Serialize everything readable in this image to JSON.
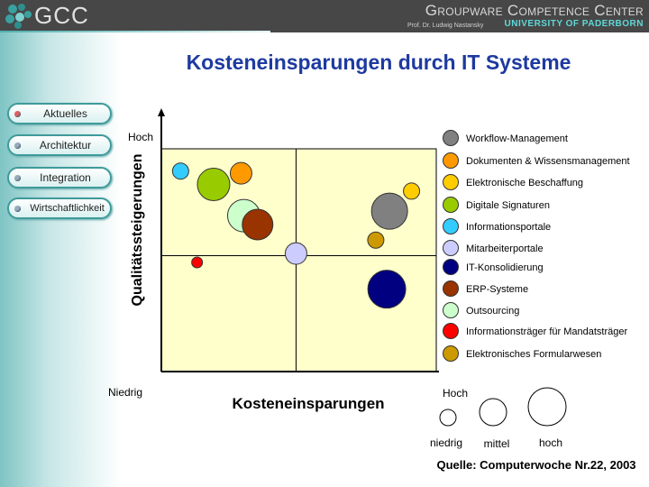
{
  "header": {
    "logo_text": "GCC",
    "org_name": "Groupware Competence Center",
    "professor": "Prof. Dr. Ludwig Nastansky",
    "university": "UNIVERSITY OF PADERBORN"
  },
  "nav": {
    "items": [
      {
        "label": "Aktuelles",
        "active": true
      },
      {
        "label": "Architektur",
        "active": false
      },
      {
        "label": "Integration",
        "active": false
      },
      {
        "label": "Wirtschaftlichkeit",
        "active": false
      }
    ]
  },
  "chart_data": {
    "type": "scatter",
    "title": "Kosteneinsparungen durch IT Systeme",
    "xlabel": "Kosteneinsparungen",
    "ylabel": "Qualitätssteigerungen",
    "x_low_label": "Niedrig",
    "x_high_label": "Hoch",
    "y_high_label": "Hoch",
    "xlim": [
      0,
      100
    ],
    "ylim": [
      0,
      100
    ],
    "quadrant_lines": {
      "x": 49,
      "y": 52
    },
    "background_color": "#ffffcc",
    "legend_placement": "right",
    "series": [
      {
        "name": "Workflow-Management",
        "color": "#808080",
        "x": 83,
        "y": 72,
        "size": 20
      },
      {
        "name": "Dokumenten & Wissensmanagement",
        "color": "#ff9900",
        "x": 29,
        "y": 89,
        "size": 12
      },
      {
        "name": "Elektronische Beschaffung",
        "color": "#ffcc00",
        "x": 91,
        "y": 81,
        "size": 9
      },
      {
        "name": "Digitale Signaturen",
        "color": "#99cc00",
        "x": 19,
        "y": 84,
        "size": 18
      },
      {
        "name": "Informationsportale",
        "color": "#33ccff",
        "x": 7,
        "y": 90,
        "size": 9
      },
      {
        "name": "Mitarbeiterportale",
        "color": "#ccccff",
        "x": 49,
        "y": 53,
        "size": 12
      },
      {
        "name": "IT-Konsolidierung",
        "color": "#000080",
        "x": 82,
        "y": 37,
        "size": 21
      },
      {
        "name": "ERP-Systeme",
        "color": "#993300",
        "x": 35,
        "y": 66,
        "size": 17
      },
      {
        "name": "Outsourcing",
        "color": "#ccffcc",
        "x": 30,
        "y": 70,
        "size": 18
      },
      {
        "name": "Informationsträger für Mandatsträger",
        "color": "#ff0000",
        "x": 13,
        "y": 49,
        "size": 6
      },
      {
        "name": "Elektronisches Formularwesen",
        "color": "#cc9900",
        "x": 78,
        "y": 59,
        "size": 9
      }
    ],
    "size_legend": {
      "title": "Hoch",
      "items": [
        {
          "label": "niedrig",
          "size": 9
        },
        {
          "label": "mittel",
          "size": 15
        },
        {
          "label": "hoch",
          "size": 21
        }
      ]
    },
    "source": "Quelle: Computerwoche Nr.22, 2003"
  }
}
